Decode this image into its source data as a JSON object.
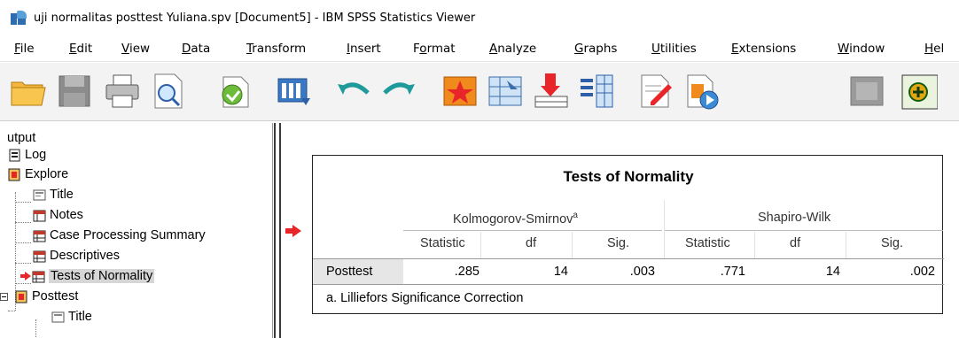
{
  "window": {
    "title": "uji normalitas posttest Yuliana.spv [Document5] - IBM SPSS Statistics Viewer"
  },
  "menu": [
    {
      "label": "File",
      "underline": "F",
      "rest": "ile"
    },
    {
      "label": "Edit",
      "underline": "E",
      "rest": "dit"
    },
    {
      "label": "View",
      "underline": "V",
      "rest": "iew"
    },
    {
      "label": "Data",
      "underline": "D",
      "rest": "ata"
    },
    {
      "label": "Transform",
      "underline": "T",
      "rest": "ransform"
    },
    {
      "label": "Insert",
      "underline": "I",
      "rest": "nsert"
    },
    {
      "label": "Format",
      "pre": "F",
      "underline": "o",
      "rest": "rmat"
    },
    {
      "label": "Analyze",
      "underline": "A",
      "rest": "nalyze"
    },
    {
      "label": "Graphs",
      "underline": "G",
      "rest": "raphs"
    },
    {
      "label": "Utilities",
      "underline": "U",
      "rest": "tilities"
    },
    {
      "label": "Extensions",
      "underline": "E",
      "rest": "xtensions"
    },
    {
      "label": "Window",
      "underline": "W",
      "rest": "indow"
    },
    {
      "label": "Hel",
      "underline": "H",
      "rest": "el"
    }
  ],
  "toolbar": [
    "open-folder-icon",
    "save-icon",
    "print-icon",
    "print-preview-icon",
    "export-icon",
    "recall-dialog-icon",
    "undo-icon",
    "redo-icon",
    "goto-data-icon",
    "goto-case-icon",
    "goto-variable-icon",
    "variables-icon",
    "designate-window-icon",
    "run-script-icon",
    "hide-icon",
    "add-output-icon"
  ],
  "outline": {
    "root": "utput",
    "items": [
      {
        "label": "Log",
        "icon": "log-icon",
        "level": 1
      },
      {
        "label": "Explore",
        "icon": "explore-book-icon",
        "level": 1
      },
      {
        "label": "Title",
        "icon": "title-icon",
        "level": 2
      },
      {
        "label": "Notes",
        "icon": "notes-icon",
        "level": 2
      },
      {
        "label": "Case Processing Summary",
        "icon": "table-icon",
        "level": 2
      },
      {
        "label": "Descriptives",
        "icon": "table-icon",
        "level": 2
      },
      {
        "label": "Tests of Normality",
        "icon": "table-icon",
        "level": 2,
        "selected": true
      },
      {
        "label": "Posttest",
        "icon": "posttest-book-icon",
        "level": 1
      },
      {
        "label": "Title",
        "icon": "title-icon",
        "level": 2
      }
    ]
  },
  "table": {
    "title": "Tests of Normality",
    "group1": "Kolmogorov-Smirnov",
    "group1_sup": "a",
    "group2": "Shapiro-Wilk",
    "columns": [
      "Statistic",
      "df",
      "Sig.",
      "Statistic",
      "df",
      "Sig."
    ],
    "row": {
      "label": "Posttest",
      "values": [
        ".285",
        "14",
        ".003",
        ".771",
        "14",
        ".002"
      ]
    },
    "footnote": "a. Lilliefors Significance Correction"
  },
  "colors": {
    "selection": "#d6d6d6",
    "arrow": "#e8262a",
    "row_header_bg": "#e6e6e6"
  }
}
